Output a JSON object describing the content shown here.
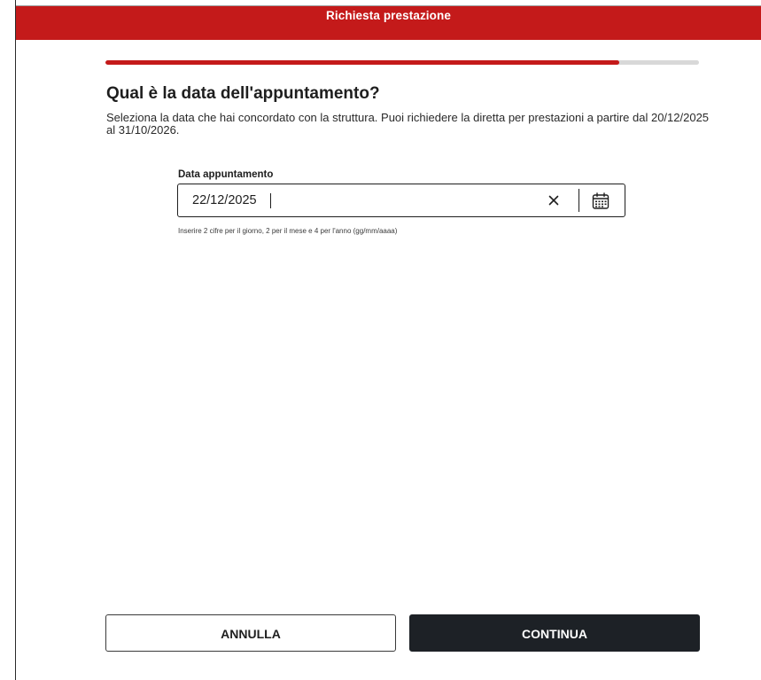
{
  "header": {
    "title": "Richiesta prestazione",
    "color": "#c41a1a"
  },
  "progress": {
    "fraction": 0.866
  },
  "question": {
    "title": "Qual è la data dell'appuntamento?",
    "description": "Seleziona la data che hai concordato con la struttura. Puoi richiedere la diretta per prestazioni a partire dal 20/12/2025 al 31/10/2026."
  },
  "date_field": {
    "label": "Data appuntamento",
    "value": "22/12/2025",
    "hint": "Inserire 2 cifre per il giorno, 2 per il mese e 4 per l'anno (gg/mm/aaaa)",
    "clear_icon": "close-icon",
    "calendar_icon": "calendar-icon"
  },
  "actions": {
    "cancel_label": "ANNULLA",
    "continue_label": "CONTINUA"
  },
  "colors": {
    "accent": "#c41a1a",
    "primary_button": "#1d2126"
  }
}
